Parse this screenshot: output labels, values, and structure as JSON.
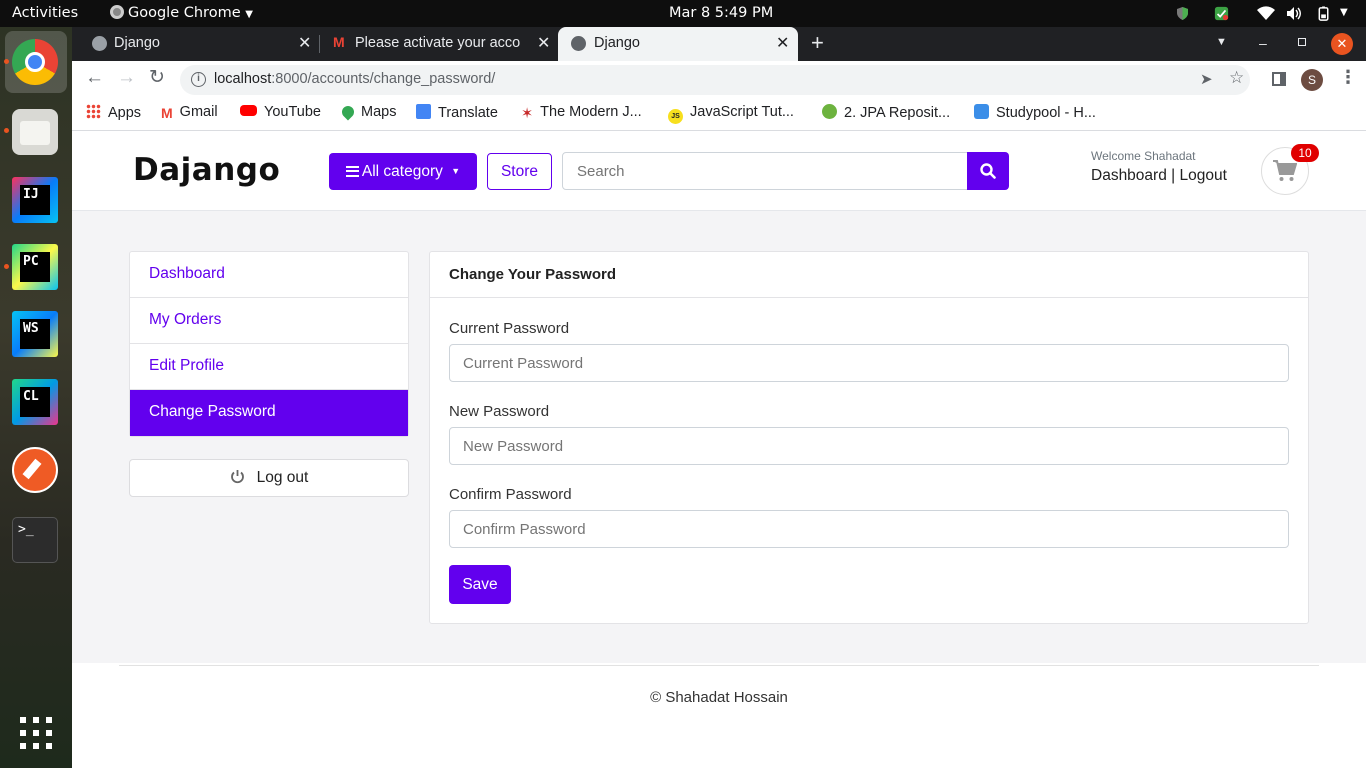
{
  "system": {
    "activities": "Activities",
    "app_menu": "Google Chrome",
    "clock": "Mar 8   5:49 PM"
  },
  "browser": {
    "tabs": [
      {
        "label": "Django"
      },
      {
        "label": "Please activate your acco"
      },
      {
        "label": "Django"
      }
    ],
    "url_host": "localhost",
    "url_rest": ":8000/accounts/change_password/",
    "profile_initial": "S",
    "bookmarks": [
      {
        "label": "Apps"
      },
      {
        "label": "Gmail"
      },
      {
        "label": "YouTube"
      },
      {
        "label": "Maps"
      },
      {
        "label": "Translate"
      },
      {
        "label": "The Modern J..."
      },
      {
        "label": "JavaScript Tut..."
      },
      {
        "label": "2. JPA Reposit..."
      },
      {
        "label": "Studypool - H..."
      }
    ]
  },
  "site": {
    "logo": "Dajango",
    "category_button": "All category",
    "store_button": "Store",
    "search_placeholder": "Search",
    "welcome": "Welcome Shahadat",
    "dashboard_link": "Dashboard",
    "separator": "|",
    "logout_link": "Logout",
    "cart_count": "10"
  },
  "sidebar": {
    "items": [
      {
        "label": "Dashboard"
      },
      {
        "label": "My Orders"
      },
      {
        "label": "Edit Profile"
      },
      {
        "label": "Change Password"
      }
    ],
    "logout": "Log out"
  },
  "form": {
    "title": "Change Your Password",
    "current_label": "Current Password",
    "current_placeholder": "Current Password",
    "new_label": "New Password",
    "new_placeholder": "New Password",
    "confirm_label": "Confirm Password",
    "confirm_placeholder": "Confirm Password",
    "save": "Save"
  },
  "footer": {
    "copyright": "© Shahadat Hossain"
  },
  "colors": {
    "accent": "#6200ee",
    "badge": "#e00000"
  }
}
